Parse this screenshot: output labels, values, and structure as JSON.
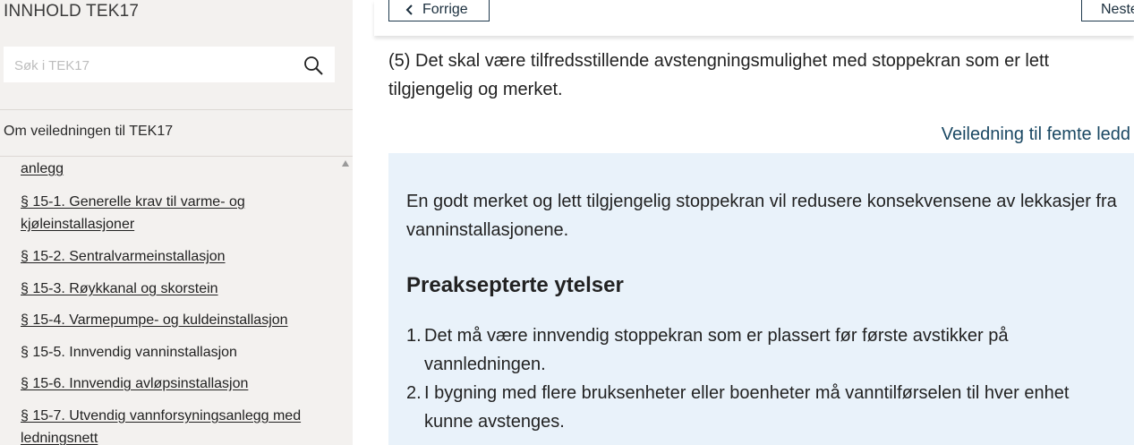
{
  "sidebar": {
    "title": "INNHOLD TEK17",
    "search": {
      "placeholder": "Søk i TEK17",
      "value": ""
    },
    "om_link": "Om veiledningen til TEK17",
    "toc": [
      {
        "label": "anlegg",
        "link": true
      },
      {
        "label": "§ 15-1. Generelle krav til varme- og kjøleinstallasjoner",
        "link": true
      },
      {
        "label": "§ 15-2. Sentralvarmeinstallasjon",
        "link": true
      },
      {
        "label": "§ 15-3. Røykkanal og skorstein",
        "link": true
      },
      {
        "label": "§ 15-4. Varmepumpe- og kuldeinstallasjon",
        "link": true
      },
      {
        "label": "§ 15-5. Innvendig vanninstallasjon",
        "link": false
      },
      {
        "label": "§ 15-6. Innvendig avløpsinstallasjon",
        "link": true
      },
      {
        "label": "§ 15-7. Utvendig vannforsyningsanlegg med ledningsnett",
        "link": true
      }
    ]
  },
  "nav": {
    "prev_label": "Forrige",
    "next_label": "Neste"
  },
  "content": {
    "paragraph": "(5) Det skal være tilfredsstillende avstengningsmulighet med stoppekran som er lett tilgjengelig og merket.",
    "guide_link": "Veiledning til femte ledd",
    "guide": {
      "intro": "En godt merket og lett tilgjengelig stoppekran vil redusere konsekvensene av lekkasjer fra vanninstallasjonene.",
      "heading": "Preaksepterte ytelser",
      "items": [
        {
          "num": "1.",
          "text": "Det må være innvendig stoppekran som er plassert før første avstikker på vannledningen."
        },
        {
          "num": "2.",
          "text": "I bygning med flere bruksenheter eller boenheter må vanntilførselen til hver enhet kunne avstenges."
        }
      ]
    }
  },
  "icons": {
    "search": "search-icon",
    "prev": "chevron-left-icon",
    "next": "chevron-right-icon",
    "scroll": "scroll-up-arrow-icon"
  }
}
